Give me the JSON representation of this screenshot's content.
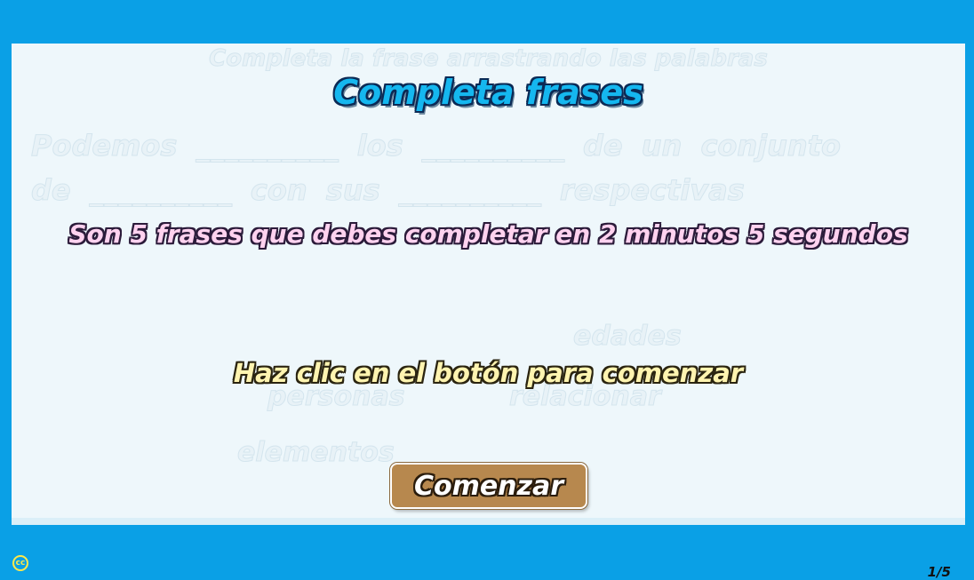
{
  "ghost": {
    "instruction": "Completa la frase arrastrando las palabras",
    "sentence_line1": "Podemos __________ los __________ de un conjunto",
    "sentence_line2": "de __________ con sus __________ respectivas",
    "words": {
      "edades": "edades",
      "personas": "personas",
      "relacionar": "relacionar",
      "elementos": "elementos"
    }
  },
  "title": "Completa frases",
  "subtitle": "Son 5 frases que debes completar en 2 minutos  5 segundos",
  "prompt": "Haz clic en el botón para comenzar",
  "start_button": "Comenzar",
  "footer": {
    "license_icon": "cc-icon",
    "license_text": "cc",
    "pager": "1/5"
  },
  "colors": {
    "background": "#0aa0e6",
    "stage": "#eef7fb",
    "title": "#15b7ef",
    "subtitle": "#ffd2ef",
    "prompt": "#fff4b0",
    "button": "#b7884e"
  }
}
